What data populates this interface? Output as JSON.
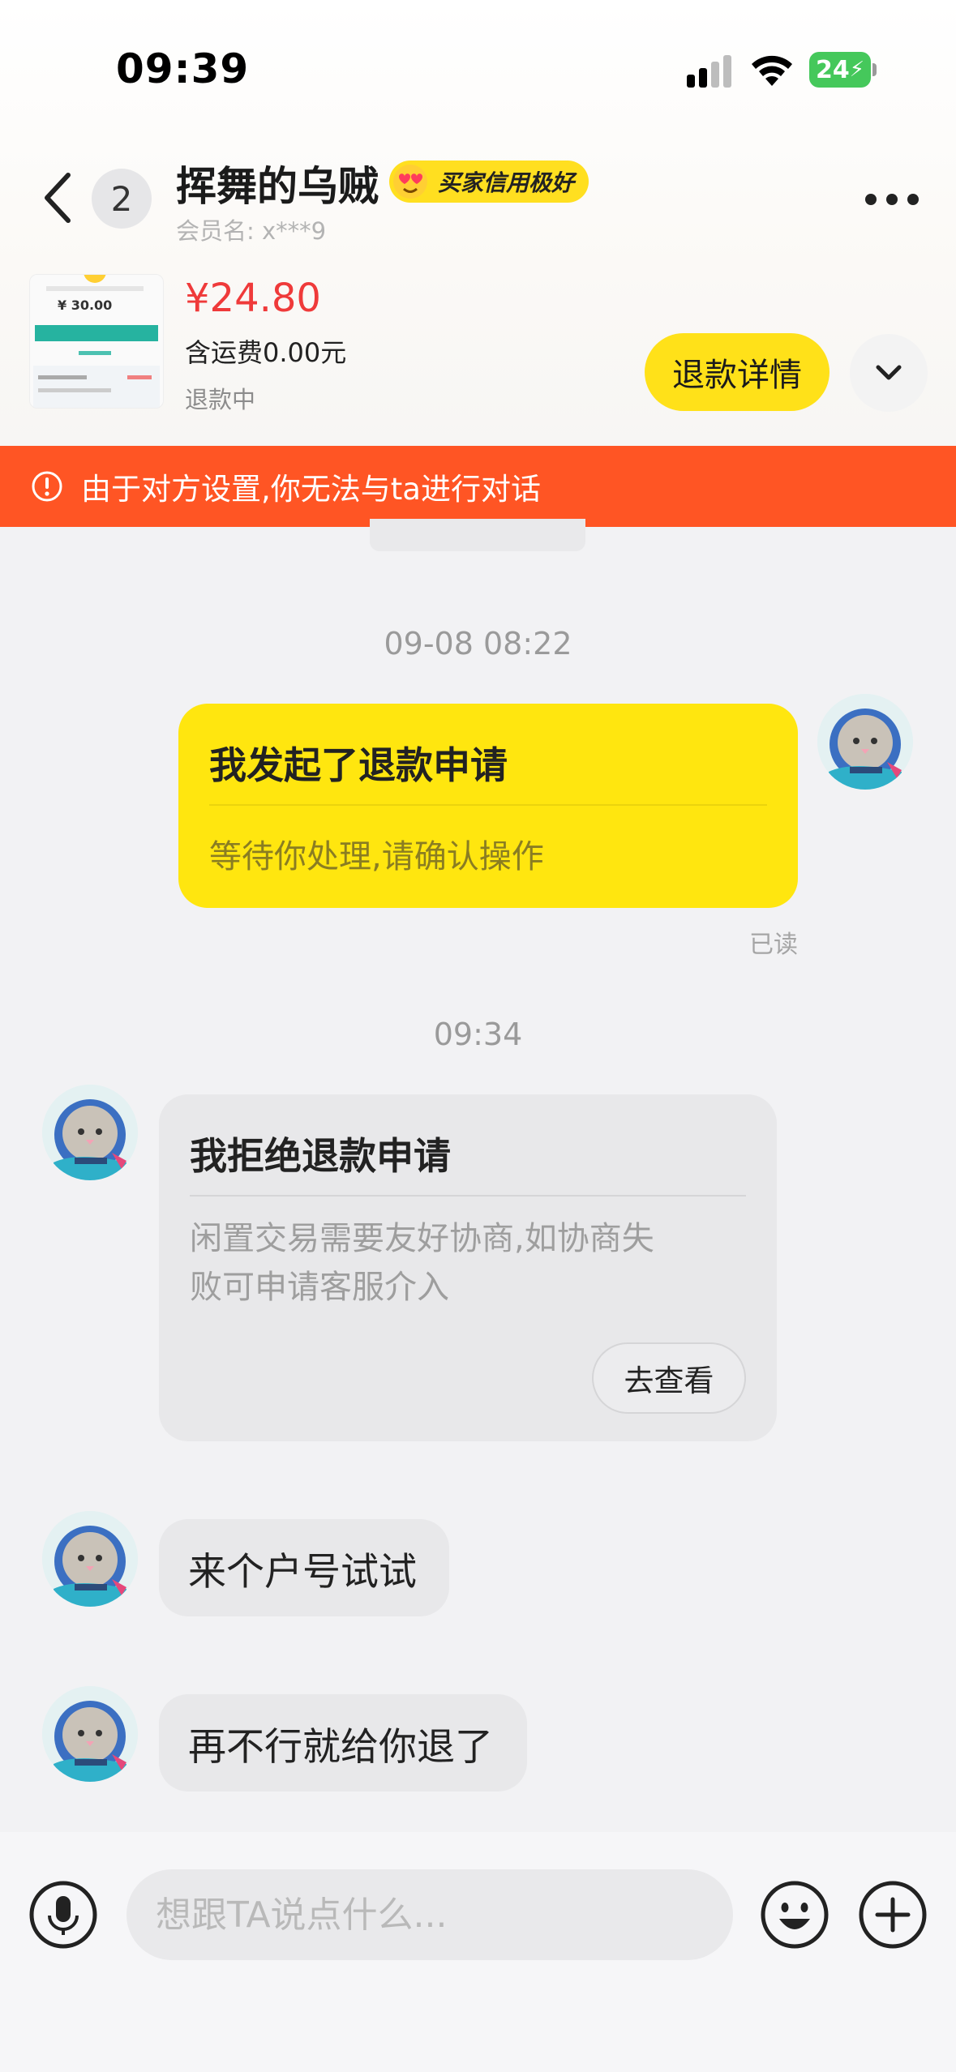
{
  "status_bar": {
    "time": "09:39",
    "battery": "24"
  },
  "header": {
    "unread_count": "2",
    "contact_name": "挥舞的乌贼",
    "credit_badge": "买家信用极好",
    "member_label": "会员名:",
    "member_name": "x***9"
  },
  "product": {
    "price": "¥24.80",
    "shipping": "含运费0.00元",
    "status": "退款中",
    "thumb_amount": "¥ 30.00",
    "refund_detail_button": "退款详情"
  },
  "banner": {
    "text": "由于对方设置,你无法与ta进行对话"
  },
  "messages": [
    {
      "type": "timestamp",
      "text": "09-08 08:22"
    },
    {
      "type": "card",
      "side": "right",
      "title": "我发起了退款申请",
      "body": "等待你处理,请确认操作",
      "read": "已读"
    },
    {
      "type": "timestamp",
      "text": "09:34"
    },
    {
      "type": "card",
      "side": "left",
      "title": "我拒绝退款申请",
      "body_line1": "闲置交易需要友好协商,如协商失",
      "body_line2": "败可申请客服介入",
      "button": "去查看"
    },
    {
      "type": "text",
      "side": "left",
      "text": "来个户号试试"
    },
    {
      "type": "text",
      "side": "left",
      "text": "再不行就给你退了"
    }
  ],
  "input": {
    "placeholder": "想跟TA说点什么..."
  },
  "colors": {
    "brand_yellow": "#ffe60f",
    "banner_orange": "#ff5524",
    "price_red": "#ef3a3a"
  },
  "icons": [
    "back-icon",
    "more-icon",
    "chevron-down-icon",
    "warning-icon",
    "microphone-icon",
    "emoji-icon",
    "plus-icon"
  ]
}
